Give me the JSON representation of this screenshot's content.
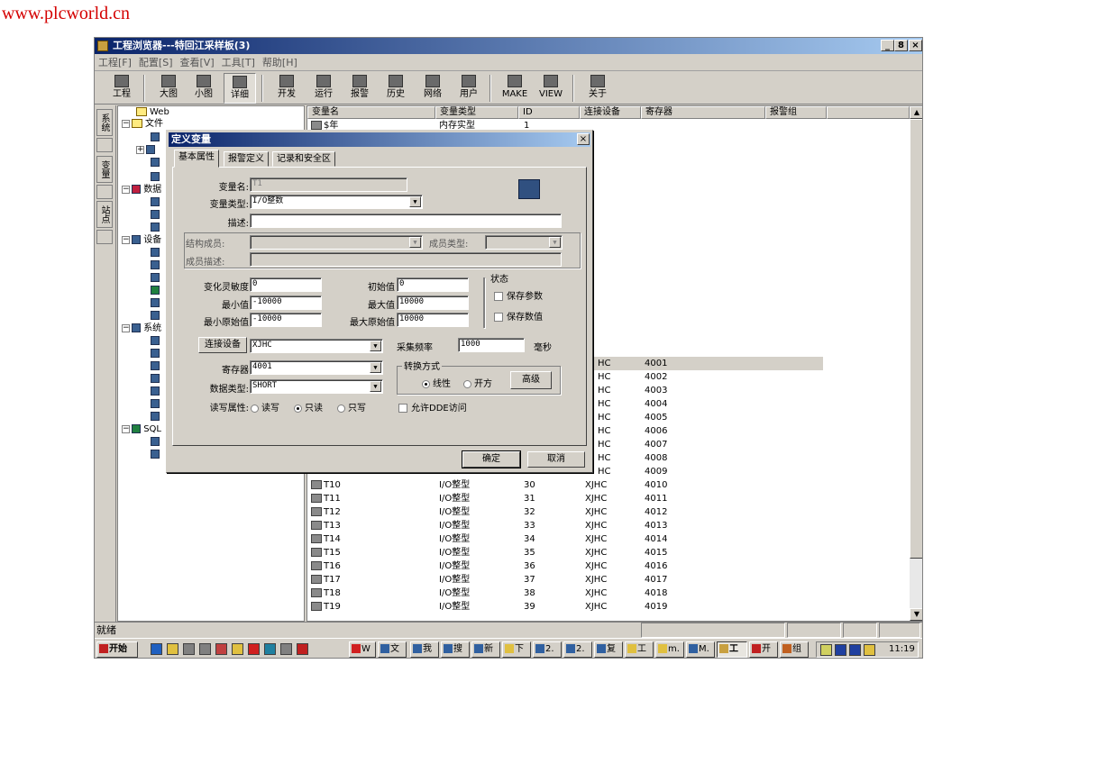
{
  "watermark": "www.plcworld.cn",
  "window": {
    "title": "工程浏览器---特回江采样板(3)",
    "min": "_",
    "max": "8",
    "close": "×"
  },
  "menu": [
    "工程[F]",
    "配置[S]",
    "查看[V]",
    "工具[T]",
    "帮助[H]"
  ],
  "toolbar": [
    "工程",
    "大图",
    "小图",
    "详细",
    "开发",
    "运行",
    "报警",
    "历史",
    "网络",
    "用户",
    "MAKE",
    "VIEW",
    "关于"
  ],
  "side_tabs": [
    "系统",
    "变量",
    "站点"
  ],
  "tree": {
    "web": "Web",
    "file": "文件",
    "data": "数据",
    "device": "设备",
    "system": "系统",
    "sql": "SQL"
  },
  "list": {
    "headers": [
      "变量名",
      "变量类型",
      "ID",
      "连接设备",
      "寄存器",
      "报警组"
    ],
    "partial": {
      "name": "$年",
      "type": "内存实型",
      "id": "1"
    },
    "rows": [
      {
        "r": "4001"
      },
      {
        "r": "4002"
      },
      {
        "r": "4003"
      },
      {
        "r": "4004"
      },
      {
        "r": "4005"
      },
      {
        "r": "4006"
      },
      {
        "r": "4007"
      },
      {
        "r": "4008"
      },
      {
        "r": "4009"
      },
      {
        "name": "T10",
        "type": "I/O整型",
        "id": "30",
        "dev": "XJHC",
        "r": "4010"
      },
      {
        "name": "T11",
        "type": "I/O整型",
        "id": "31",
        "dev": "XJHC",
        "r": "4011"
      },
      {
        "name": "T12",
        "type": "I/O整型",
        "id": "32",
        "dev": "XJHC",
        "r": "4012"
      },
      {
        "name": "T13",
        "type": "I/O整型",
        "id": "33",
        "dev": "XJHC",
        "r": "4013"
      },
      {
        "name": "T14",
        "type": "I/O整型",
        "id": "34",
        "dev": "XJHC",
        "r": "4014"
      },
      {
        "name": "T15",
        "type": "I/O整型",
        "id": "35",
        "dev": "XJHC",
        "r": "4015"
      },
      {
        "name": "T16",
        "type": "I/O整型",
        "id": "36",
        "dev": "XJHC",
        "r": "4016"
      },
      {
        "name": "T17",
        "type": "I/O整型",
        "id": "37",
        "dev": "XJHC",
        "r": "4017"
      },
      {
        "name": "T18",
        "type": "I/O整型",
        "id": "38",
        "dev": "XJHC",
        "r": "4018"
      },
      {
        "name": "T19",
        "type": "I/O整型",
        "id": "39",
        "dev": "XJHC",
        "r": "4019"
      }
    ],
    "dev_stub": "HC"
  },
  "status": "就绪",
  "taskbar": {
    "start": "开始",
    "tasks": [
      "W",
      "文",
      "我",
      "搜",
      "新",
      "下",
      "2.",
      "2.",
      "复",
      "工",
      "m.",
      "M.",
      "工",
      "开",
      "组"
    ],
    "clock": "11:19"
  },
  "dialog": {
    "title": "定义变量",
    "close": "×",
    "tabs": [
      "基本属性",
      "报警定义",
      "记录和安全区"
    ],
    "var_name_label": "变量名:",
    "var_name": "T1",
    "var_type_label": "变量类型:",
    "var_type": "I/O整数",
    "desc_label": "描述:",
    "desc": "",
    "struct_label": "结构成员:",
    "member_type_label": "成员类型:",
    "member_desc_label": "成员描述:",
    "sens_label": "变化灵敏度",
    "sens": "0",
    "init_label": "初始值",
    "init": "0",
    "min_label": "最小值",
    "min": "-10000",
    "max_label": "最大值",
    "max": "10000",
    "rawmin_label": "最小原始值",
    "rawmin": "-10000",
    "rawmax_label": "最大原始值",
    "rawmax": "10000",
    "state_label": "状态",
    "save_param": "保存参数",
    "save_value": "保存数值",
    "conn_btn": "连接设备",
    "conn": "XJHC",
    "freq_label": "采集频率",
    "freq": "1000",
    "freq_unit": "毫秒",
    "reg_label": "寄存器",
    "reg": "4001",
    "dtype_label": "数据类型:",
    "dtype": "SHORT",
    "conv_label": "转换方式",
    "linear": "线性",
    "sqrt": "开方",
    "advanced": "高级",
    "rw_label": "读写属性:",
    "rw": "读写",
    "ro": "只读",
    "wo": "只写",
    "dde": "允许DDE访问",
    "ok": "确定",
    "cancel": "取消"
  }
}
